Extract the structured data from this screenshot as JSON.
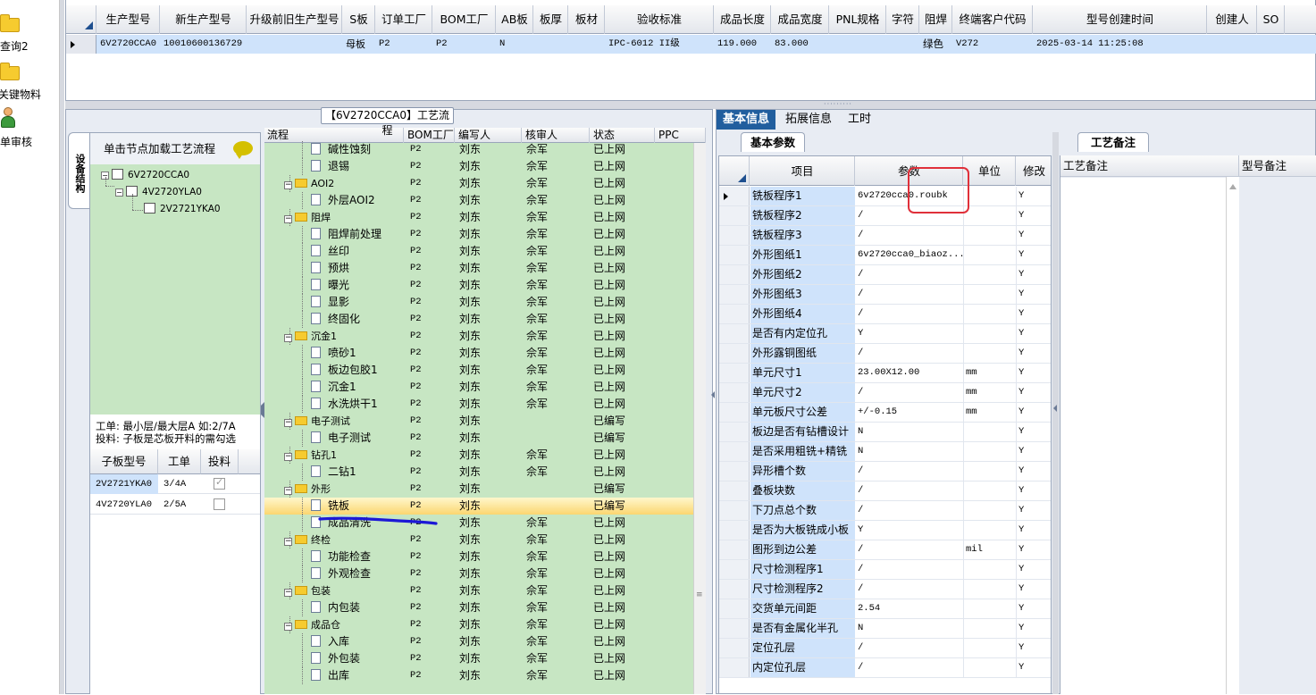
{
  "leftbar": {
    "items": [
      {
        "label": "查询2"
      },
      {
        "label": "关键物料"
      },
      {
        "label": "单审核"
      }
    ]
  },
  "top_grid": {
    "columns": [
      "生产型号",
      "新生产型号",
      "升级前旧生产型号",
      "S板",
      "订单工厂",
      "BOM工厂",
      "AB板",
      "板厚",
      "板材",
      "验收标准",
      "成品长度",
      "成品宽度",
      "PNL规格",
      "字符",
      "阻焊",
      "终端客户代码",
      "型号创建时间",
      "创建人",
      "SO"
    ],
    "row": {
      "生产型号": "6V2720CCA0",
      "新生产型号": "10010600136729",
      "S板": "母板",
      "订单工厂": "P2",
      "BOM工厂": "P2",
      "AB板": "N",
      "验收标准": "IPC-6012 II级",
      "成品长度": "119.000",
      "成品宽度": "83.000",
      "阻焊": "绿色",
      "终端客户代码": "V272",
      "型号创建时间": "2025-03-14 11:25:08"
    }
  },
  "process_panel": {
    "title": "【6V2720CCA0】工艺流程",
    "side_tab": "设备结构",
    "tree_header": "单击节点加载工艺流程",
    "tree": [
      {
        "label": "6V2720CCA0",
        "level": 0
      },
      {
        "label": "4V2720YLA0",
        "level": 1
      },
      {
        "label": "2V2721YKA0",
        "level": 2
      }
    ],
    "note_line1": "工单: 最小层/最大层A 如:2/7A",
    "note_line2": "投料: 子板是芯板开料的需勾选",
    "sub_grid": {
      "columns": [
        "子板型号",
        "工单",
        "投料"
      ],
      "rows": [
        {
          "model": "2V2721YKA0",
          "order": "3/4A",
          "checked": true
        },
        {
          "model": "4V2720YLA0",
          "order": "2/5A",
          "checked": false
        }
      ]
    },
    "flow_grid": {
      "columns": [
        "流程",
        "BOM工厂",
        "编写人",
        "核审人",
        "状态",
        "PPC"
      ],
      "rows": [
        {
          "name": "碱性蚀刻",
          "kind": "item",
          "factory": "P2",
          "writer": "刘东",
          "reviewer": "佘军",
          "status": "已上网"
        },
        {
          "name": "退锡",
          "kind": "item",
          "factory": "P2",
          "writer": "刘东",
          "reviewer": "佘军",
          "status": "已上网"
        },
        {
          "name": "AOI2",
          "kind": "group",
          "factory": "P2",
          "writer": "刘东",
          "reviewer": "佘军",
          "status": "已上网"
        },
        {
          "name": "外层AOI2",
          "kind": "item",
          "factory": "P2",
          "writer": "刘东",
          "reviewer": "佘军",
          "status": "已上网"
        },
        {
          "name": "阻焊",
          "kind": "group",
          "factory": "P2",
          "writer": "刘东",
          "reviewer": "佘军",
          "status": "已上网"
        },
        {
          "name": "阻焊前处理",
          "kind": "item",
          "factory": "P2",
          "writer": "刘东",
          "reviewer": "佘军",
          "status": "已上网"
        },
        {
          "name": "丝印",
          "kind": "item",
          "factory": "P2",
          "writer": "刘东",
          "reviewer": "佘军",
          "status": "已上网"
        },
        {
          "name": "预烘",
          "kind": "item",
          "factory": "P2",
          "writer": "刘东",
          "reviewer": "佘军",
          "status": "已上网"
        },
        {
          "name": "曝光",
          "kind": "item",
          "factory": "P2",
          "writer": "刘东",
          "reviewer": "佘军",
          "status": "已上网"
        },
        {
          "name": "显影",
          "kind": "item",
          "factory": "P2",
          "writer": "刘东",
          "reviewer": "佘军",
          "status": "已上网"
        },
        {
          "name": "终固化",
          "kind": "item",
          "factory": "P2",
          "writer": "刘东",
          "reviewer": "佘军",
          "status": "已上网"
        },
        {
          "name": "沉金1",
          "kind": "group",
          "factory": "P2",
          "writer": "刘东",
          "reviewer": "佘军",
          "status": "已上网"
        },
        {
          "name": "喷砂1",
          "kind": "item",
          "factory": "P2",
          "writer": "刘东",
          "reviewer": "佘军",
          "status": "已上网"
        },
        {
          "name": "板边包胶1",
          "kind": "item",
          "factory": "P2",
          "writer": "刘东",
          "reviewer": "佘军",
          "status": "已上网"
        },
        {
          "name": "沉金1",
          "kind": "item",
          "factory": "P2",
          "writer": "刘东",
          "reviewer": "佘军",
          "status": "已上网"
        },
        {
          "name": "水洗烘干1",
          "kind": "item",
          "factory": "P2",
          "writer": "刘东",
          "reviewer": "佘军",
          "status": "已上网"
        },
        {
          "name": "电子测试",
          "kind": "group",
          "factory": "P2",
          "writer": "刘东",
          "reviewer": "",
          "status": "已编写"
        },
        {
          "name": "电子测试",
          "kind": "item",
          "factory": "P2",
          "writer": "刘东",
          "reviewer": "",
          "status": "已编写"
        },
        {
          "name": "钻孔1",
          "kind": "group",
          "factory": "P2",
          "writer": "刘东",
          "reviewer": "佘军",
          "status": "已上网"
        },
        {
          "name": "二钻1",
          "kind": "item",
          "factory": "P2",
          "writer": "刘东",
          "reviewer": "佘军",
          "status": "已上网"
        },
        {
          "name": "外形",
          "kind": "group",
          "factory": "P2",
          "writer": "刘东",
          "reviewer": "",
          "status": "已编写"
        },
        {
          "name": "铣板",
          "kind": "item",
          "factory": "P2",
          "writer": "刘东",
          "reviewer": "",
          "status": "已编写",
          "selected": true
        },
        {
          "name": "成品清洗",
          "kind": "item",
          "factory": "P2",
          "writer": "刘东",
          "reviewer": "佘军",
          "status": "已上网"
        },
        {
          "name": "终检",
          "kind": "group",
          "factory": "P2",
          "writer": "刘东",
          "reviewer": "佘军",
          "status": "已上网"
        },
        {
          "name": "功能检查",
          "kind": "item",
          "factory": "P2",
          "writer": "刘东",
          "reviewer": "佘军",
          "status": "已上网"
        },
        {
          "name": "外观检查",
          "kind": "item",
          "factory": "P2",
          "writer": "刘东",
          "reviewer": "佘军",
          "status": "已上网"
        },
        {
          "name": "包装",
          "kind": "group",
          "factory": "P2",
          "writer": "刘东",
          "reviewer": "佘军",
          "status": "已上网"
        },
        {
          "name": "内包装",
          "kind": "item",
          "factory": "P2",
          "writer": "刘东",
          "reviewer": "佘军",
          "status": "已上网"
        },
        {
          "name": "成品仓",
          "kind": "group",
          "factory": "P2",
          "writer": "刘东",
          "reviewer": "佘军",
          "status": "已上网"
        },
        {
          "name": "入库",
          "kind": "item",
          "factory": "P2",
          "writer": "刘东",
          "reviewer": "佘军",
          "status": "已上网"
        },
        {
          "name": "外包装",
          "kind": "item",
          "factory": "P2",
          "writer": "刘东",
          "reviewer": "佘军",
          "status": "已上网"
        },
        {
          "name": "出库",
          "kind": "item",
          "factory": "P2",
          "writer": "刘东",
          "reviewer": "佘军",
          "status": "已上网"
        }
      ]
    }
  },
  "right_panel": {
    "tabs": [
      "基本信息",
      "拓展信息",
      "工时"
    ],
    "sub_tab": "基本参数",
    "notes_tab": "工艺备注",
    "param_columns": [
      "项目",
      "参数",
      "单位",
      "修改"
    ],
    "params": [
      {
        "name": "铣板程序1",
        "value": "6v2720cca0.roubk",
        "unit": "",
        "mod": "Y"
      },
      {
        "name": "铣板程序2",
        "value": "/",
        "unit": "",
        "mod": "Y"
      },
      {
        "name": "铣板程序3",
        "value": "/",
        "unit": "",
        "mod": "Y"
      },
      {
        "name": "外形图纸1",
        "value": "6v2720cca0_biaoz...",
        "unit": "",
        "mod": "Y"
      },
      {
        "name": "外形图纸2",
        "value": "/",
        "unit": "",
        "mod": "Y"
      },
      {
        "name": "外形图纸3",
        "value": "/",
        "unit": "",
        "mod": "Y"
      },
      {
        "name": "外形图纸4",
        "value": "/",
        "unit": "",
        "mod": "Y"
      },
      {
        "name": "是否有内定位孔",
        "value": "Y",
        "unit": "",
        "mod": "Y"
      },
      {
        "name": "外形露铜图纸",
        "value": "/",
        "unit": "",
        "mod": "Y"
      },
      {
        "name": "单元尺寸1",
        "value": "23.00X12.00",
        "unit": "mm",
        "mod": "Y"
      },
      {
        "name": "单元尺寸2",
        "value": "/",
        "unit": "mm",
        "mod": "Y"
      },
      {
        "name": "单元板尺寸公差",
        "value": "+/-0.15",
        "unit": "mm",
        "mod": "Y"
      },
      {
        "name": "板边是否有钻槽设计",
        "value": "N",
        "unit": "",
        "mod": "Y"
      },
      {
        "name": "是否采用粗铣+精铣",
        "value": "N",
        "unit": "",
        "mod": "Y"
      },
      {
        "name": "异形槽个数",
        "value": "/",
        "unit": "",
        "mod": "Y"
      },
      {
        "name": "叠板块数",
        "value": "/",
        "unit": "",
        "mod": "Y"
      },
      {
        "name": "下刀点总个数",
        "value": "/",
        "unit": "",
        "mod": "Y"
      },
      {
        "name": "是否为大板铣成小板",
        "value": "Y",
        "unit": "",
        "mod": "Y"
      },
      {
        "name": "图形到边公差",
        "value": "/",
        "unit": "mil",
        "mod": "Y"
      },
      {
        "name": "尺寸检测程序1",
        "value": "/",
        "unit": "",
        "mod": "Y"
      },
      {
        "name": "尺寸检测程序2",
        "value": "/",
        "unit": "",
        "mod": "Y"
      },
      {
        "name": "交货单元间距",
        "value": "2.54",
        "unit": "",
        "mod": "Y"
      },
      {
        "name": "是否有金属化半孔",
        "value": "N",
        "unit": "",
        "mod": "Y"
      },
      {
        "name": "定位孔层",
        "value": "/",
        "unit": "",
        "mod": "Y"
      },
      {
        "name": "内定位孔层",
        "value": "/",
        "unit": "",
        "mod": "Y"
      }
    ],
    "notes_columns": [
      "工艺备注",
      "型号备注"
    ]
  }
}
